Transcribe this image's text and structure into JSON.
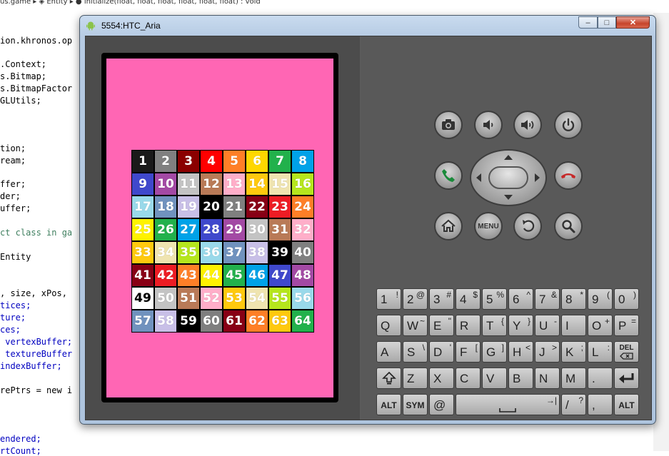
{
  "editor": {
    "tab_text": "us.game  ▸ ◈ Entity  ▸ ● initialize(float, float, float, float, float, float) : void",
    "lines": [
      {
        "text": "ion.khronos.op",
        "kind": "kw"
      },
      {
        "text": ".Context;",
        "kind": "kw"
      },
      {
        "text": "s.Bitmap;",
        "kind": "kw"
      },
      {
        "text": "s.BitmapFactor",
        "kind": "kw"
      },
      {
        "text": "GLUtils;",
        "kind": "kw"
      },
      {
        "text": "tion;",
        "kind": "kw"
      },
      {
        "text": "ream;",
        "kind": "kw"
      },
      {
        "text": "ffer;",
        "kind": "kw"
      },
      {
        "text": "der;",
        "kind": "kw"
      },
      {
        "text": "uffer;",
        "kind": "kw"
      },
      {
        "text": "ct class in ga",
        "kind": "cm"
      },
      {
        "text": "Entity",
        "kind": "kw"
      },
      {
        "text": ", size, xPos,",
        "kind": "kw"
      },
      {
        "text": "tices;",
        "kind": "fld"
      },
      {
        "text": "ture;",
        "kind": "fld"
      },
      {
        "text": "ces;",
        "kind": "fld"
      },
      {
        "text": " vertexBuffer;",
        "kind": "fld"
      },
      {
        "text": " textureBuffer",
        "kind": "fld"
      },
      {
        "text": "indexBuffer;",
        "kind": "fld"
      },
      {
        "text": "rePtrs = new i",
        "kind": "kw"
      },
      {
        "text": "endered;",
        "kind": "fld"
      },
      {
        "text": "rtCount;",
        "kind": "fld"
      }
    ]
  },
  "window": {
    "title": "5554:HTC_Aria",
    "minimize": "–",
    "maximize": "□",
    "close": "✕"
  },
  "screen": {
    "background": "#ff66b4",
    "tiles": [
      {
        "label": "1",
        "bg": "#1a1a1a",
        "fg": "#ffffff"
      },
      {
        "label": "2",
        "bg": "#808080",
        "fg": "#ffffff"
      },
      {
        "label": "3",
        "bg": "#8b0000",
        "fg": "#ffffff"
      },
      {
        "label": "4",
        "bg": "#ff0000",
        "fg": "#ffffff"
      },
      {
        "label": "5",
        "bg": "#ff7f27",
        "fg": "#ffffff"
      },
      {
        "label": "6",
        "bg": "#ffd700",
        "fg": "#ffffff"
      },
      {
        "label": "7",
        "bg": "#22b14c",
        "fg": "#ffffff"
      },
      {
        "label": "8",
        "bg": "#00a2e8",
        "fg": "#ffffff"
      },
      {
        "label": "9",
        "bg": "#3f48cc",
        "fg": "#ffffff"
      },
      {
        "label": "10",
        "bg": "#a349a4",
        "fg": "#ffffff"
      },
      {
        "label": "11",
        "bg": "#c3c3c3",
        "fg": "#ffffff"
      },
      {
        "label": "12",
        "bg": "#b97a57",
        "fg": "#ffffff"
      },
      {
        "label": "13",
        "bg": "#ffaec9",
        "fg": "#ffffff"
      },
      {
        "label": "14",
        "bg": "#ffc90e",
        "fg": "#ffffff"
      },
      {
        "label": "15",
        "bg": "#efe4b0",
        "fg": "#ffffff"
      },
      {
        "label": "16",
        "bg": "#b5e61d",
        "fg": "#ffffff"
      },
      {
        "label": "17",
        "bg": "#99d9ea",
        "fg": "#ffffff"
      },
      {
        "label": "18",
        "bg": "#7092be",
        "fg": "#ffffff"
      },
      {
        "label": "19",
        "bg": "#c8bfe7",
        "fg": "#ffffff"
      },
      {
        "label": "20",
        "bg": "#000000",
        "fg": "#ffffff"
      },
      {
        "label": "21",
        "bg": "#7f7f7f",
        "fg": "#ffffff"
      },
      {
        "label": "22",
        "bg": "#880015",
        "fg": "#ffffff"
      },
      {
        "label": "23",
        "bg": "#ed1c24",
        "fg": "#ffffff"
      },
      {
        "label": "24",
        "bg": "#ff7f27",
        "fg": "#ffffff"
      },
      {
        "label": "25",
        "bg": "#fff200",
        "fg": "#ffffff"
      },
      {
        "label": "26",
        "bg": "#22b14c",
        "fg": "#ffffff"
      },
      {
        "label": "27",
        "bg": "#00a2e8",
        "fg": "#ffffff"
      },
      {
        "label": "28",
        "bg": "#3f48cc",
        "fg": "#ffffff"
      },
      {
        "label": "29",
        "bg": "#a349a4",
        "fg": "#ffffff"
      },
      {
        "label": "30",
        "bg": "#c3c3c3",
        "fg": "#ffffff"
      },
      {
        "label": "31",
        "bg": "#b97a57",
        "fg": "#ffffff"
      },
      {
        "label": "32",
        "bg": "#ffaec9",
        "fg": "#ffffff"
      },
      {
        "label": "33",
        "bg": "#ffc90e",
        "fg": "#ffffff"
      },
      {
        "label": "34",
        "bg": "#efe4b0",
        "fg": "#ffffff"
      },
      {
        "label": "35",
        "bg": "#b5e61d",
        "fg": "#ffffff"
      },
      {
        "label": "36",
        "bg": "#99d9ea",
        "fg": "#ffffff"
      },
      {
        "label": "37",
        "bg": "#7092be",
        "fg": "#ffffff"
      },
      {
        "label": "38",
        "bg": "#c8bfe7",
        "fg": "#ffffff"
      },
      {
        "label": "39",
        "bg": "#000000",
        "fg": "#ffffff"
      },
      {
        "label": "40",
        "bg": "#7f7f7f",
        "fg": "#ffffff"
      },
      {
        "label": "41",
        "bg": "#880015",
        "fg": "#ffffff"
      },
      {
        "label": "42",
        "bg": "#ed1c24",
        "fg": "#ffffff"
      },
      {
        "label": "43",
        "bg": "#ff7f27",
        "fg": "#ffffff"
      },
      {
        "label": "44",
        "bg": "#fff200",
        "fg": "#ffffff"
      },
      {
        "label": "45",
        "bg": "#22b14c",
        "fg": "#ffffff"
      },
      {
        "label": "46",
        "bg": "#00a2e8",
        "fg": "#ffffff"
      },
      {
        "label": "47",
        "bg": "#3f48cc",
        "fg": "#ffffff"
      },
      {
        "label": "48",
        "bg": "#a349a4",
        "fg": "#ffffff"
      },
      {
        "label": "49",
        "bg": "#ffffff",
        "fg": "#000000"
      },
      {
        "label": "50",
        "bg": "#c3c3c3",
        "fg": "#ffffff"
      },
      {
        "label": "51",
        "bg": "#b97a57",
        "fg": "#ffffff"
      },
      {
        "label": "52",
        "bg": "#ffaec9",
        "fg": "#ffffff"
      },
      {
        "label": "53",
        "bg": "#ffc90e",
        "fg": "#ffffff"
      },
      {
        "label": "54",
        "bg": "#efe4b0",
        "fg": "#ffffff"
      },
      {
        "label": "55",
        "bg": "#b5e61d",
        "fg": "#ffffff"
      },
      {
        "label": "56",
        "bg": "#99d9ea",
        "fg": "#ffffff"
      },
      {
        "label": "57",
        "bg": "#7092be",
        "fg": "#ffffff"
      },
      {
        "label": "58",
        "bg": "#c8bfe7",
        "fg": "#ffffff"
      },
      {
        "label": "59",
        "bg": "#000000",
        "fg": "#ffffff"
      },
      {
        "label": "60",
        "bg": "#7f7f7f",
        "fg": "#ffffff"
      },
      {
        "label": "61",
        "bg": "#880015",
        "fg": "#ffffff"
      },
      {
        "label": "62",
        "bg": "#ff7f27",
        "fg": "#ffffff"
      },
      {
        "label": "63",
        "bg": "#ffc90e",
        "fg": "#ffffff"
      },
      {
        "label": "64",
        "bg": "#22b14c",
        "fg": "#ffffff"
      }
    ]
  },
  "controls": {
    "menu_label": "MENU",
    "icons": {
      "camera": "camera-icon",
      "volume_down": "volume-down-icon",
      "volume_up": "volume-up-icon",
      "power": "power-icon",
      "call": "call-icon",
      "end_call": "end-call-icon",
      "home": "home-icon",
      "back": "back-icon",
      "search": "search-icon"
    },
    "colors": {
      "call": "#1a8a3a",
      "end_call": "#c62828"
    }
  },
  "keyboard": {
    "row1": [
      {
        "main": "1",
        "alt": "!"
      },
      {
        "main": "2",
        "alt": "@"
      },
      {
        "main": "3",
        "alt": "#"
      },
      {
        "main": "4",
        "alt": "$"
      },
      {
        "main": "5",
        "alt": "%"
      },
      {
        "main": "6",
        "alt": "^"
      },
      {
        "main": "7",
        "alt": "&"
      },
      {
        "main": "8",
        "alt": "*"
      },
      {
        "main": "9",
        "alt": "("
      },
      {
        "main": "0",
        "alt": ")"
      }
    ],
    "row2": [
      {
        "main": "Q",
        "alt": ""
      },
      {
        "main": "W",
        "alt": "~"
      },
      {
        "main": "E",
        "alt": "\""
      },
      {
        "main": "R",
        "alt": ""
      },
      {
        "main": "T",
        "alt": "{"
      },
      {
        "main": "Y",
        "alt": "}"
      },
      {
        "main": "U",
        "alt": "-"
      },
      {
        "main": "I",
        "alt": ""
      },
      {
        "main": "O",
        "alt": "+"
      },
      {
        "main": "P",
        "alt": "="
      }
    ],
    "row3": [
      {
        "main": "A",
        "alt": ""
      },
      {
        "main": "S",
        "alt": "\\"
      },
      {
        "main": "D",
        "alt": "'"
      },
      {
        "main": "F",
        "alt": "["
      },
      {
        "main": "G",
        "alt": "]"
      },
      {
        "main": "H",
        "alt": "<"
      },
      {
        "main": "J",
        "alt": ">"
      },
      {
        "main": "K",
        "alt": ";"
      },
      {
        "main": "L",
        "alt": ":"
      },
      {
        "main": "",
        "alt": "",
        "special": "DEL"
      }
    ],
    "row4": [
      {
        "main": "",
        "alt": "",
        "special": "SHIFT"
      },
      {
        "main": "Z",
        "alt": ""
      },
      {
        "main": "X",
        "alt": ""
      },
      {
        "main": "C",
        "alt": ""
      },
      {
        "main": "V",
        "alt": ""
      },
      {
        "main": "B",
        "alt": ""
      },
      {
        "main": "N",
        "alt": ""
      },
      {
        "main": "M",
        "alt": ""
      },
      {
        "main": ".",
        "alt": ""
      },
      {
        "main": "",
        "alt": "",
        "special": "ENTER"
      }
    ],
    "row5": {
      "alt_left": "ALT",
      "sym": "SYM",
      "at": "@",
      "space_alt": "→|",
      "slash": "/",
      "slash_alt": "?",
      "comma": ",",
      "alt_right": "ALT"
    }
  }
}
